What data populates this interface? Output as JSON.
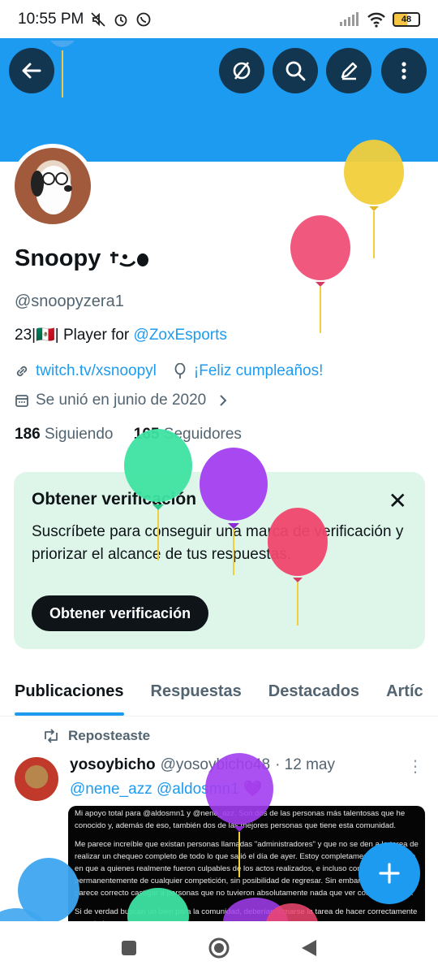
{
  "status_bar": {
    "time": "10:55 PM",
    "battery": "48"
  },
  "header": {
    "back_icon": "arrow-left-icon",
    "icons": [
      "no-filter-icon",
      "search-icon",
      "edit-icon",
      "more-vertical-icon"
    ],
    "banner_color": "#1d9bf0"
  },
  "profile": {
    "name": "Snoopy",
    "handle": "@snoopyzera1",
    "bio_prefix": "23|🇲🇽| Player for ",
    "bio_link": "@ZoxEsports",
    "website": "twitch.tv/xsnoopyl",
    "birthday": "¡Feliz cumpleaños!",
    "joined": "Se unió en junio de 2020",
    "following_count": "186",
    "following_label": "Siguiendo",
    "followers_count": "165",
    "followers_label": "Seguidores"
  },
  "verify_card": {
    "title": "Obtener verificación",
    "body": "Suscríbete para conseguir una marca de verificación y priorizar el alcance de tus respuestas.",
    "button": "Obtener verificación"
  },
  "tabs": [
    "Publicaciones",
    "Respuestas",
    "Destacados",
    "Artíc"
  ],
  "post": {
    "repost_label": "Reposteaste",
    "user": "yosoybicho",
    "handle": "@yosoybicho48",
    "date": "· 12 may",
    "mentions": "@nene_azz @aldosmn1 💜",
    "image_paragraphs": [
      "Mi apoyo total para @aldosmn1 y @nene_azz. Son dos de las personas más talentosas que he conocido y, además de eso, también dos de las mejores personas que tiene esta comunidad.",
      "Me parece increíble que existan personas llamadas \"administradores\" y que no se den a la tarea de realizar un chequeo completo de todo lo que salió el día de ayer. Estoy completamente de acuerdo en que a quienes realmente fueron culpables de los actos realizados, e incluso con banearlos permanentemente de cualquier competición, sin posibilidad de regresar. Sin embargo, no me parece correcto castigar a personas que no tuvieron absolutamente nada que ver con la situación.",
      "Si de verdad buscan un bien para la comunidad, deberían tomarse la tarea de hacer correctamente su trabajo."
    ]
  }
}
